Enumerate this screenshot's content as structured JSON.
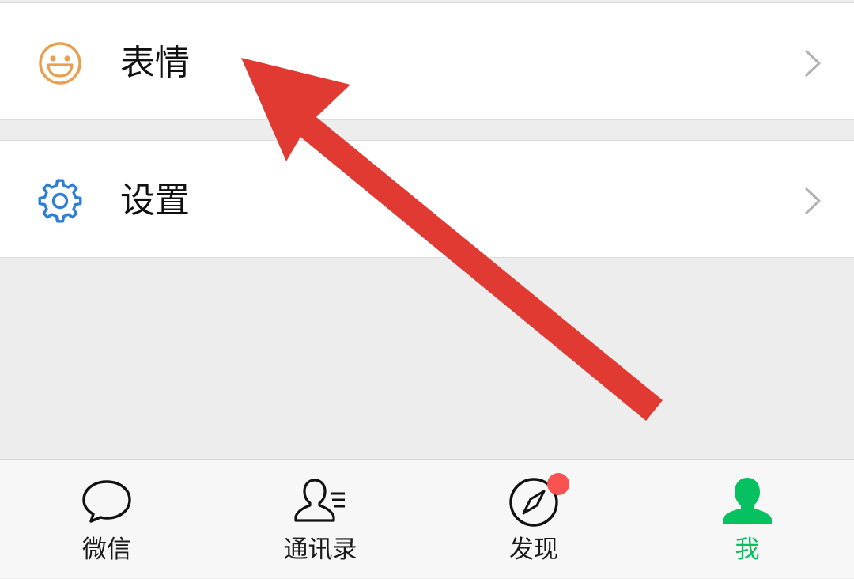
{
  "menu": {
    "stickers": {
      "label": "表情",
      "icon": "smile-icon"
    },
    "settings": {
      "label": "设置",
      "icon": "gear-icon"
    }
  },
  "tabbar": {
    "items": [
      {
        "label": "微信",
        "icon": "chat-bubble-icon",
        "active": false
      },
      {
        "label": "通讯录",
        "icon": "contacts-icon",
        "active": false
      },
      {
        "label": "发现",
        "icon": "compass-icon",
        "active": false,
        "badge": true
      },
      {
        "label": "我",
        "icon": "person-icon",
        "active": true
      }
    ]
  },
  "annotation": {
    "icon": "red-arrow-icon"
  },
  "colors": {
    "accent_green": "#07c160",
    "smile_orange": "#e8a050",
    "gear_blue": "#2b7fd6",
    "badge_red": "#fa5151",
    "arrow_red": "#e03a33",
    "background": "#ededed"
  }
}
